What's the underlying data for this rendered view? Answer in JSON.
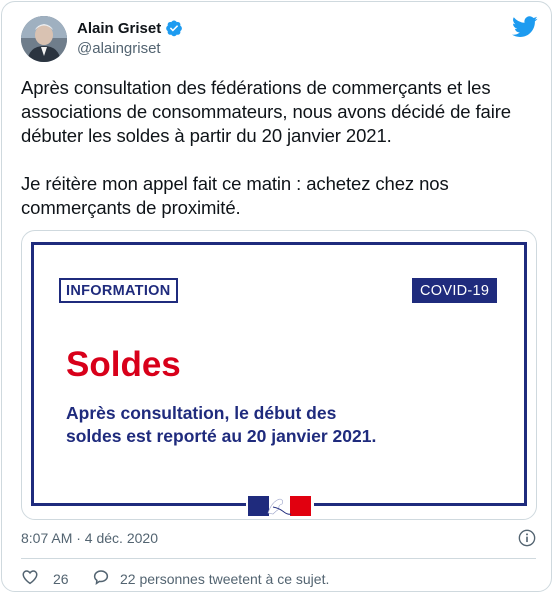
{
  "author": {
    "display_name": "Alain Griset",
    "handle": "@alaingriset",
    "verified_icon": "verified-badge-icon",
    "avatar_icon": "avatar"
  },
  "brand_icon": "twitter-bird-icon",
  "tweet": {
    "paragraph_1": "Après consultation des fédérations  de commerçants et les associations de consommateurs, nous avons décidé de faire débuter les soldes à partir du 20 janvier 2021.",
    "paragraph_2": "Je réitère mon appel fait ce matin : achetez chez nos commerçants de proximité."
  },
  "media": {
    "info_label": "INFORMATION",
    "covid_label": "COVID-19",
    "title": "Soldes",
    "body_line_1": "Après consultation, le début des",
    "body_line_2": "soldes est reporté au 20 janvier 2021.",
    "logo_icon": "marianne-logo-icon"
  },
  "meta": {
    "timestamp": "8:07 AM · 4 déc. 2020",
    "info_icon": "info-icon"
  },
  "actions": {
    "like_count": "26",
    "reply_text": "22 personnes tweetent à ce sujet."
  },
  "colors": {
    "twitter_blue": "#1d9bf0",
    "navy": "#1f2b7d",
    "red": "#d8001a",
    "muted_text": "#536471",
    "border": "#cfd9de"
  }
}
